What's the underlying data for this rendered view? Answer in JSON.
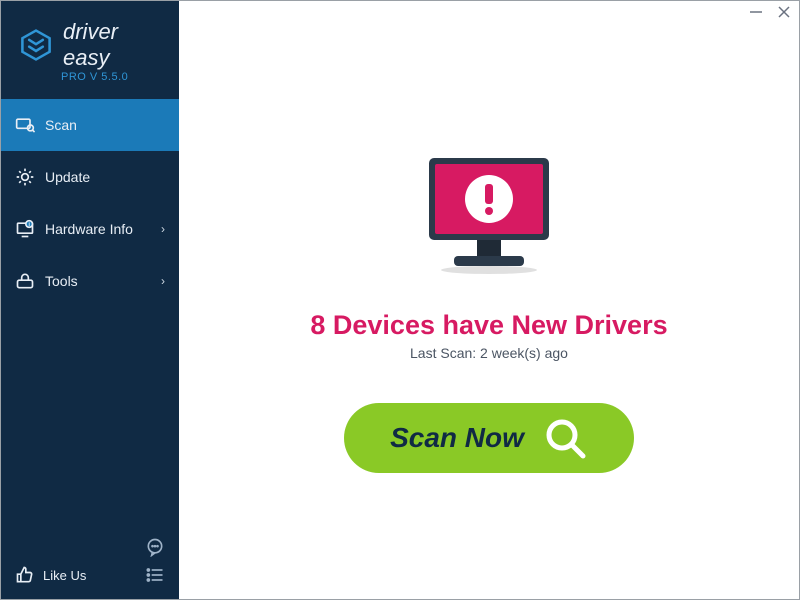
{
  "brand": {
    "name": "driver easy",
    "version_label": "PRO V 5.5.0"
  },
  "nav": {
    "scan": "Scan",
    "update": "Update",
    "hardware_info": "Hardware Info",
    "tools": "Tools"
  },
  "bottom": {
    "like_us": "Like Us"
  },
  "main": {
    "headline": "8 Devices have New Drivers",
    "last_scan": "Last Scan: 2 week(s) ago",
    "scan_now": "Scan Now"
  },
  "colors": {
    "accent": "#1b7ab8",
    "headline": "#d71a62",
    "cta": "#8ac926"
  }
}
